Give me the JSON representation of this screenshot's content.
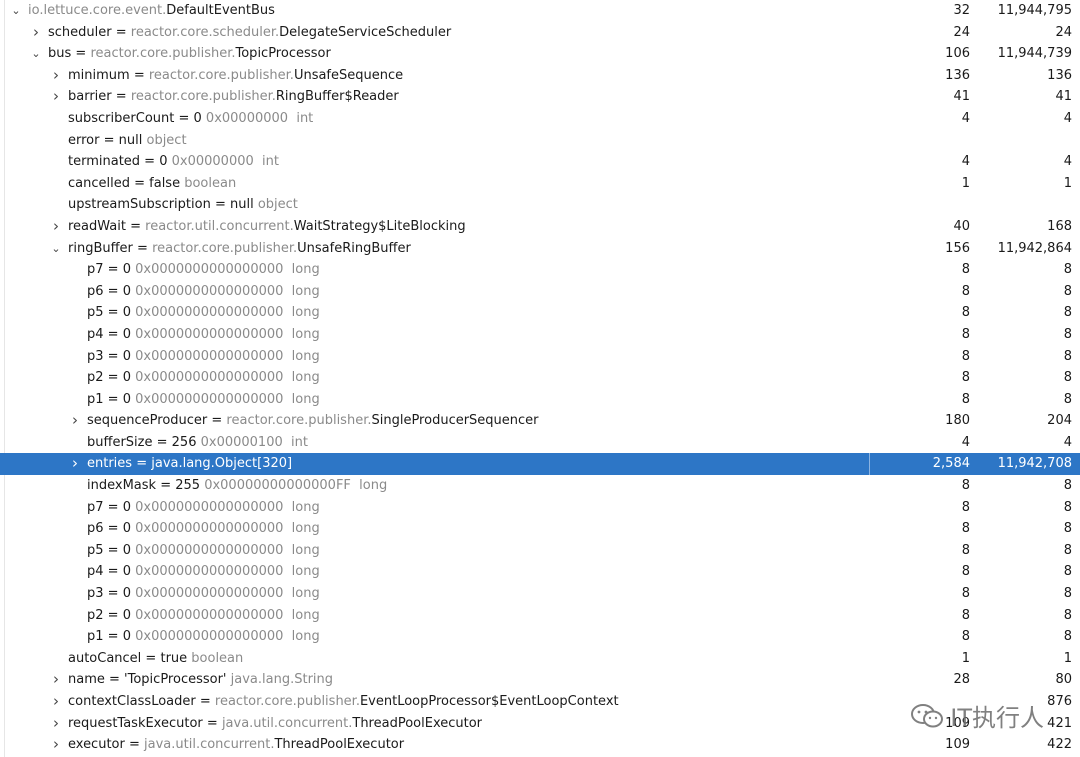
{
  "rows": [
    {
      "depth": 0,
      "arrow": "open",
      "name": "",
      "eq": "",
      "pkg": "io.lettuce.core.event.",
      "cls": "DefaultEventBus",
      "extra": "",
      "c1": "32",
      "c2": "11,944,795",
      "selected": false
    },
    {
      "depth": 1,
      "arrow": "closed",
      "name": "scheduler",
      "eq": " = ",
      "pkg": "reactor.core.scheduler.",
      "cls": "DelegateServiceScheduler",
      "extra": "",
      "c1": "24",
      "c2": "24",
      "selected": false
    },
    {
      "depth": 1,
      "arrow": "open",
      "name": "bus",
      "eq": " = ",
      "pkg": "reactor.core.publisher.",
      "cls": "TopicProcessor",
      "extra": "",
      "c1": "106",
      "c2": "11,944,739",
      "selected": false
    },
    {
      "depth": 2,
      "arrow": "closed",
      "name": "minimum",
      "eq": " = ",
      "pkg": "reactor.core.publisher.",
      "cls": "UnsafeSequence",
      "extra": "",
      "c1": "136",
      "c2": "136",
      "selected": false
    },
    {
      "depth": 2,
      "arrow": "closed",
      "name": "barrier",
      "eq": " = ",
      "pkg": "reactor.core.publisher.",
      "cls": "RingBuffer$Reader",
      "extra": "",
      "c1": "41",
      "c2": "41",
      "selected": false
    },
    {
      "depth": 2,
      "arrow": "none",
      "name": "subscriberCount",
      "eq": " = ",
      "cls": "0",
      "pkg": "",
      "extra": " 0x00000000  int",
      "c1": "4",
      "c2": "4",
      "selected": false
    },
    {
      "depth": 2,
      "arrow": "none",
      "name": "error",
      "eq": " = ",
      "cls": "null",
      "pkg": "",
      "extra": " object",
      "c1": "",
      "c2": "",
      "selected": false
    },
    {
      "depth": 2,
      "arrow": "none",
      "name": "terminated",
      "eq": " = ",
      "cls": "0",
      "pkg": "",
      "extra": " 0x00000000  int",
      "c1": "4",
      "c2": "4",
      "selected": false
    },
    {
      "depth": 2,
      "arrow": "none",
      "name": "cancelled",
      "eq": " = ",
      "cls": "false",
      "pkg": "",
      "extra": " boolean",
      "c1": "1",
      "c2": "1",
      "selected": false
    },
    {
      "depth": 2,
      "arrow": "none",
      "name": "upstreamSubscription",
      "eq": " = ",
      "cls": "null",
      "pkg": "",
      "extra": " object",
      "c1": "",
      "c2": "",
      "selected": false
    },
    {
      "depth": 2,
      "arrow": "closed",
      "name": "readWait",
      "eq": " = ",
      "pkg": "reactor.util.concurrent.",
      "cls": "WaitStrategy$LiteBlocking",
      "extra": "",
      "c1": "40",
      "c2": "168",
      "selected": false
    },
    {
      "depth": 2,
      "arrow": "open",
      "name": "ringBuffer",
      "eq": " = ",
      "pkg": "reactor.core.publisher.",
      "cls": "UnsafeRingBuffer",
      "extra": "",
      "c1": "156",
      "c2": "11,942,864",
      "selected": false
    },
    {
      "depth": 3,
      "arrow": "none",
      "name": "p7",
      "eq": " = ",
      "cls": "0",
      "pkg": "",
      "extra": " 0x0000000000000000  long",
      "c1": "8",
      "c2": "8",
      "selected": false
    },
    {
      "depth": 3,
      "arrow": "none",
      "name": "p6",
      "eq": " = ",
      "cls": "0",
      "pkg": "",
      "extra": " 0x0000000000000000  long",
      "c1": "8",
      "c2": "8",
      "selected": false
    },
    {
      "depth": 3,
      "arrow": "none",
      "name": "p5",
      "eq": " = ",
      "cls": "0",
      "pkg": "",
      "extra": " 0x0000000000000000  long",
      "c1": "8",
      "c2": "8",
      "selected": false
    },
    {
      "depth": 3,
      "arrow": "none",
      "name": "p4",
      "eq": " = ",
      "cls": "0",
      "pkg": "",
      "extra": " 0x0000000000000000  long",
      "c1": "8",
      "c2": "8",
      "selected": false
    },
    {
      "depth": 3,
      "arrow": "none",
      "name": "p3",
      "eq": " = ",
      "cls": "0",
      "pkg": "",
      "extra": " 0x0000000000000000  long",
      "c1": "8",
      "c2": "8",
      "selected": false
    },
    {
      "depth": 3,
      "arrow": "none",
      "name": "p2",
      "eq": " = ",
      "cls": "0",
      "pkg": "",
      "extra": " 0x0000000000000000  long",
      "c1": "8",
      "c2": "8",
      "selected": false
    },
    {
      "depth": 3,
      "arrow": "none",
      "name": "p1",
      "eq": " = ",
      "cls": "0",
      "pkg": "",
      "extra": " 0x0000000000000000  long",
      "c1": "8",
      "c2": "8",
      "selected": false
    },
    {
      "depth": 3,
      "arrow": "closed",
      "name": "sequenceProducer",
      "eq": " = ",
      "pkg": "reactor.core.publisher.",
      "cls": "SingleProducerSequencer",
      "extra": "",
      "c1": "180",
      "c2": "204",
      "selected": false
    },
    {
      "depth": 3,
      "arrow": "none",
      "name": "bufferSize",
      "eq": " = ",
      "cls": "256",
      "pkg": "",
      "extra": " 0x00000100  int",
      "c1": "4",
      "c2": "4",
      "selected": false
    },
    {
      "depth": 3,
      "arrow": "closed",
      "name": "entries",
      "eq": " = ",
      "pkg": "",
      "cls": "java.lang.Object[320]",
      "extra": "",
      "c1": "2,584",
      "c2": "11,942,708",
      "selected": true
    },
    {
      "depth": 3,
      "arrow": "none",
      "name": "indexMask",
      "eq": " = ",
      "cls": "255",
      "pkg": "",
      "extra": " 0x00000000000000FF  long",
      "c1": "8",
      "c2": "8",
      "selected": false
    },
    {
      "depth": 3,
      "arrow": "none",
      "name": "p7",
      "eq": " = ",
      "cls": "0",
      "pkg": "",
      "extra": " 0x0000000000000000  long",
      "c1": "8",
      "c2": "8",
      "selected": false
    },
    {
      "depth": 3,
      "arrow": "none",
      "name": "p6",
      "eq": " = ",
      "cls": "0",
      "pkg": "",
      "extra": " 0x0000000000000000  long",
      "c1": "8",
      "c2": "8",
      "selected": false
    },
    {
      "depth": 3,
      "arrow": "none",
      "name": "p5",
      "eq": " = ",
      "cls": "0",
      "pkg": "",
      "extra": " 0x0000000000000000  long",
      "c1": "8",
      "c2": "8",
      "selected": false
    },
    {
      "depth": 3,
      "arrow": "none",
      "name": "p4",
      "eq": " = ",
      "cls": "0",
      "pkg": "",
      "extra": " 0x0000000000000000  long",
      "c1": "8",
      "c2": "8",
      "selected": false
    },
    {
      "depth": 3,
      "arrow": "none",
      "name": "p3",
      "eq": " = ",
      "cls": "0",
      "pkg": "",
      "extra": " 0x0000000000000000  long",
      "c1": "8",
      "c2": "8",
      "selected": false
    },
    {
      "depth": 3,
      "arrow": "none",
      "name": "p2",
      "eq": " = ",
      "cls": "0",
      "pkg": "",
      "extra": " 0x0000000000000000  long",
      "c1": "8",
      "c2": "8",
      "selected": false
    },
    {
      "depth": 3,
      "arrow": "none",
      "name": "p1",
      "eq": " = ",
      "cls": "0",
      "pkg": "",
      "extra": " 0x0000000000000000  long",
      "c1": "8",
      "c2": "8",
      "selected": false
    },
    {
      "depth": 2,
      "arrow": "none",
      "name": "autoCancel",
      "eq": " = ",
      "cls": "true",
      "pkg": "",
      "extra": " boolean",
      "c1": "1",
      "c2": "1",
      "selected": false
    },
    {
      "depth": 2,
      "arrow": "closed",
      "name": "name",
      "eq": " = ",
      "cls": "'TopicProcessor'",
      "pkg": "",
      "extra": " java.lang.String",
      "c1": "28",
      "c2": "80",
      "selected": false
    },
    {
      "depth": 2,
      "arrow": "closed",
      "name": "contextClassLoader",
      "eq": " = ",
      "pkg": "reactor.core.publisher.",
      "cls": "EventLoopProcessor$EventLoopContext",
      "extra": "",
      "c1": "",
      "c2": "876",
      "selected": false
    },
    {
      "depth": 2,
      "arrow": "closed",
      "name": "requestTaskExecutor",
      "eq": " = ",
      "pkg": "java.util.concurrent.",
      "cls": "ThreadPoolExecutor",
      "extra": "",
      "c1": "109",
      "c2": "421",
      "selected": false
    },
    {
      "depth": 2,
      "arrow": "closed",
      "name": "executor",
      "eq": " = ",
      "pkg": "java.util.concurrent.",
      "cls": "ThreadPoolExecutor",
      "extra": "",
      "c1": "109",
      "c2": "422",
      "selected": false
    }
  ],
  "icons": {
    "open": "chevron-down-icon",
    "closed": "chevron-right-icon"
  },
  "colors": {
    "selection": "#2d76c6",
    "muted": "#8a8a8a"
  },
  "watermark": {
    "text": "IT执行人",
    "icon": "wechat-icon"
  }
}
